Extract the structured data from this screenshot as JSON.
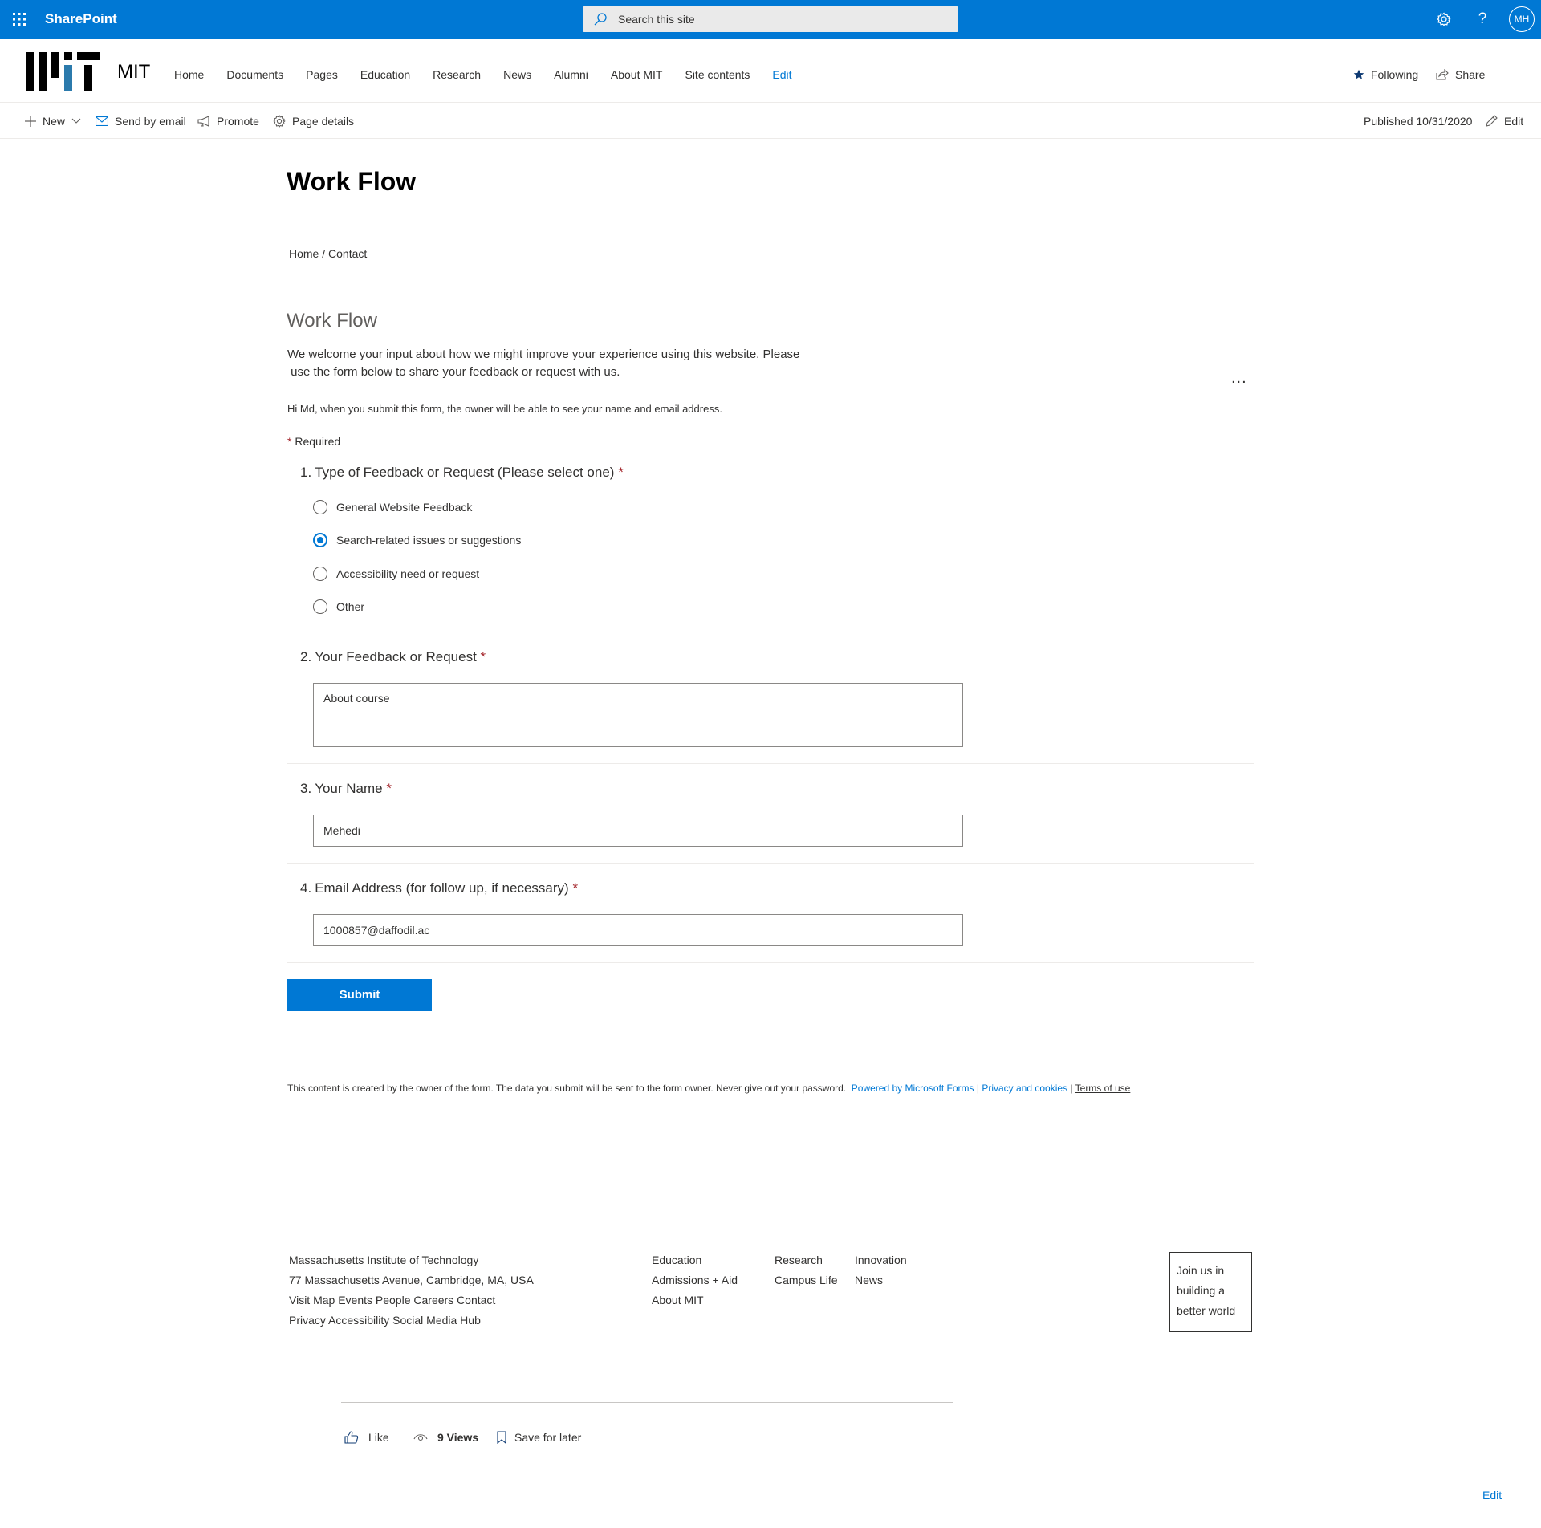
{
  "suite_bar": {
    "app_name": "SharePoint",
    "search_placeholder": "Search this site",
    "avatar_initials": "MH",
    "icons": [
      "waffle-icon",
      "search-icon",
      "gear-icon",
      "help-icon"
    ]
  },
  "site_header": {
    "site_title": "MIT",
    "nav_items": [
      "Home",
      "Documents",
      "Pages",
      "Education",
      "Research",
      "News",
      "Alumni",
      "About MIT",
      "Site contents"
    ],
    "nav_edit": "Edit",
    "following_label": "Following",
    "share_label": "Share"
  },
  "command_bar": {
    "new_label": "New",
    "send_email_label": "Send by email",
    "promote_label": "Promote",
    "page_details_label": "Page details",
    "published_text": "Published 10/31/2020",
    "edit_label": "Edit"
  },
  "page": {
    "title": "Work Flow",
    "breadcrumb": "Home / Contact"
  },
  "form": {
    "title": "Work Flow",
    "description": "We welcome your input about how we might improve your experience using this website. Please\n use the form below to share your feedback or request with us.",
    "more_options": "...",
    "hi_note": "Hi Md, when you submit this form, the owner will be able to see your name and email address.",
    "required_label": "Required",
    "q1": {
      "number": "1.",
      "label": "Type of Feedback or Request (Please select one)",
      "options": [
        "General Website Feedback",
        "Search-related issues or suggestions",
        "Accessibility need or request",
        "Other"
      ],
      "selected": "Search-related issues or suggestions"
    },
    "q2": {
      "number": "2.",
      "label": "Your Feedback or Request",
      "value": "About course"
    },
    "q3": {
      "number": "3.",
      "label": "Your Name",
      "value": "Mehedi"
    },
    "q4": {
      "number": "4.",
      "label": "Email Address (for follow up, if necessary)",
      "value": "1000857@daffodil.ac"
    },
    "submit_label": "Submit",
    "disclaimer": "This content is created by the owner of the form. The data you submit will be sent to the form owner. Never give out your password.",
    "powered_by": "Powered by Microsoft Forms",
    "privacy": "Privacy and cookies",
    "terms": "Terms of use",
    "separator": "|"
  },
  "footer": {
    "address_lines": [
      "Massachusetts Institute of Technology",
      "77 Massachusetts Avenue, Cambridge, MA, USA",
      "Visit Map Events People Careers Contact",
      "Privacy Accessibility Social Media Hub"
    ],
    "col_education": [
      "Education",
      "Admissions + Aid",
      "About MIT"
    ],
    "col_research": [
      "Research",
      "Campus Life"
    ],
    "col_innovation": [
      "Innovation",
      "News"
    ],
    "join_lines": [
      "Join us in",
      "building a",
      "better world"
    ]
  },
  "social_bar": {
    "like_label": "Like",
    "views_label": "9 Views",
    "save_label": "Save for later"
  },
  "bottom_edit": "Edit",
  "colors": {
    "accent": "#0078d4",
    "required": "#a4262c",
    "text": "#323130"
  }
}
